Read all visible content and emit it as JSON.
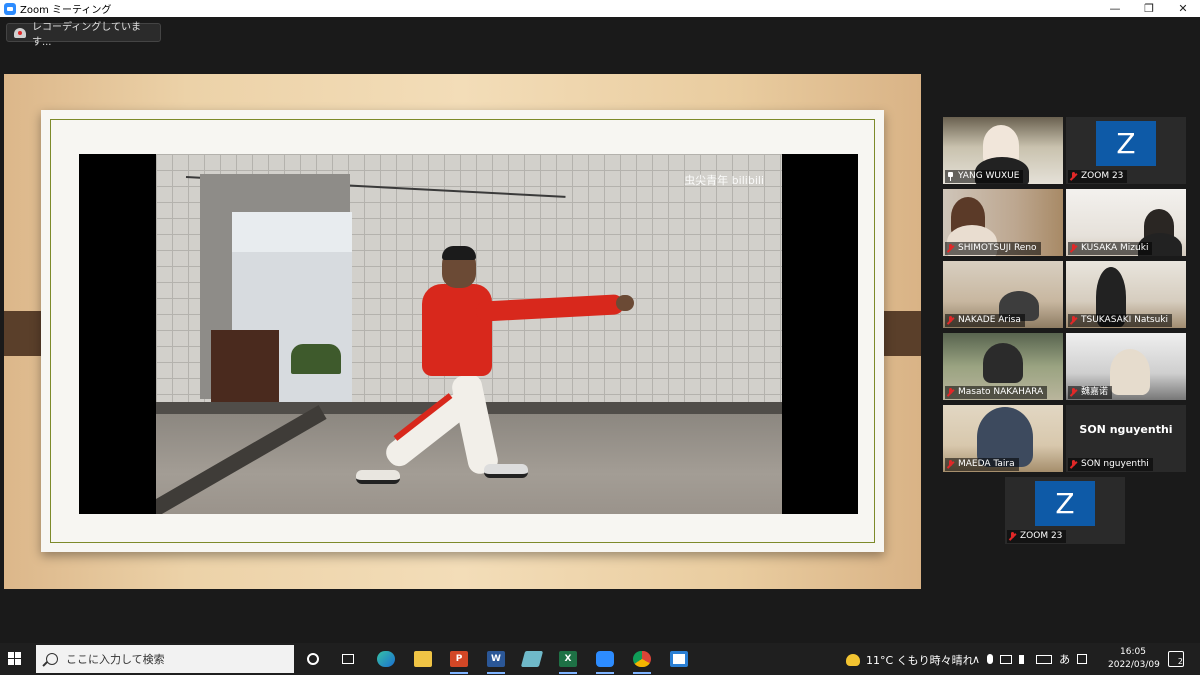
{
  "window": {
    "title": "Zoom ミーティング",
    "minimize": "—",
    "maximize": "❐",
    "close": "✕"
  },
  "recording": {
    "label": "レコーディングしています..."
  },
  "share": {
    "watermark": "虫尖青年 bilibili"
  },
  "gallery": {
    "tiles": [
      {
        "name": "YANG WUXUE",
        "type": "video",
        "pinned": true
      },
      {
        "name": "ZOOM 23",
        "type": "avatar",
        "avatar_letter": "Z"
      },
      {
        "name": "SHIMOTSUJI Reno",
        "type": "video"
      },
      {
        "name": "KUSAKA Mizuki",
        "type": "video"
      },
      {
        "name": "NAKADE Arisa",
        "type": "video"
      },
      {
        "name": "TSUKASAKI Natsuki",
        "type": "video"
      },
      {
        "name": "Masato NAKAHARA",
        "type": "video",
        "active_speaker": true
      },
      {
        "name": "魏嘉诺",
        "type": "video"
      },
      {
        "name": "MAEDA Taira",
        "type": "video"
      },
      {
        "name": "SON nguyenthi",
        "type": "name-only",
        "display_name": "SON nguyenthi"
      },
      {
        "name": "ZOOM 23",
        "type": "avatar",
        "avatar_letter": "Z"
      }
    ],
    "active_speaker_color": "#c8e23a",
    "avatar_color": "#0e5aa7",
    "muted_mic_color": "#e02828"
  },
  "taskbar": {
    "search_placeholder": "ここに入力して検索",
    "apps": [
      {
        "icon": "cortana-icon"
      },
      {
        "icon": "task-view-icon"
      },
      {
        "icon": "edge-icon"
      },
      {
        "icon": "file-explorer-icon"
      },
      {
        "icon": "powerpoint-icon",
        "letter": "P"
      },
      {
        "icon": "word-icon",
        "letter": "W"
      },
      {
        "icon": "notes-icon"
      },
      {
        "icon": "excel-icon",
        "letter": "X"
      },
      {
        "icon": "zoom-icon"
      },
      {
        "icon": "chrome-icon"
      },
      {
        "icon": "app-icon"
      }
    ],
    "weather": "11°C くもり時々晴れ",
    "tray": {
      "chevron": "∧",
      "ime": "あ"
    },
    "clock": {
      "time": "16:05",
      "date": "2022/03/09"
    },
    "notifications": "2"
  }
}
